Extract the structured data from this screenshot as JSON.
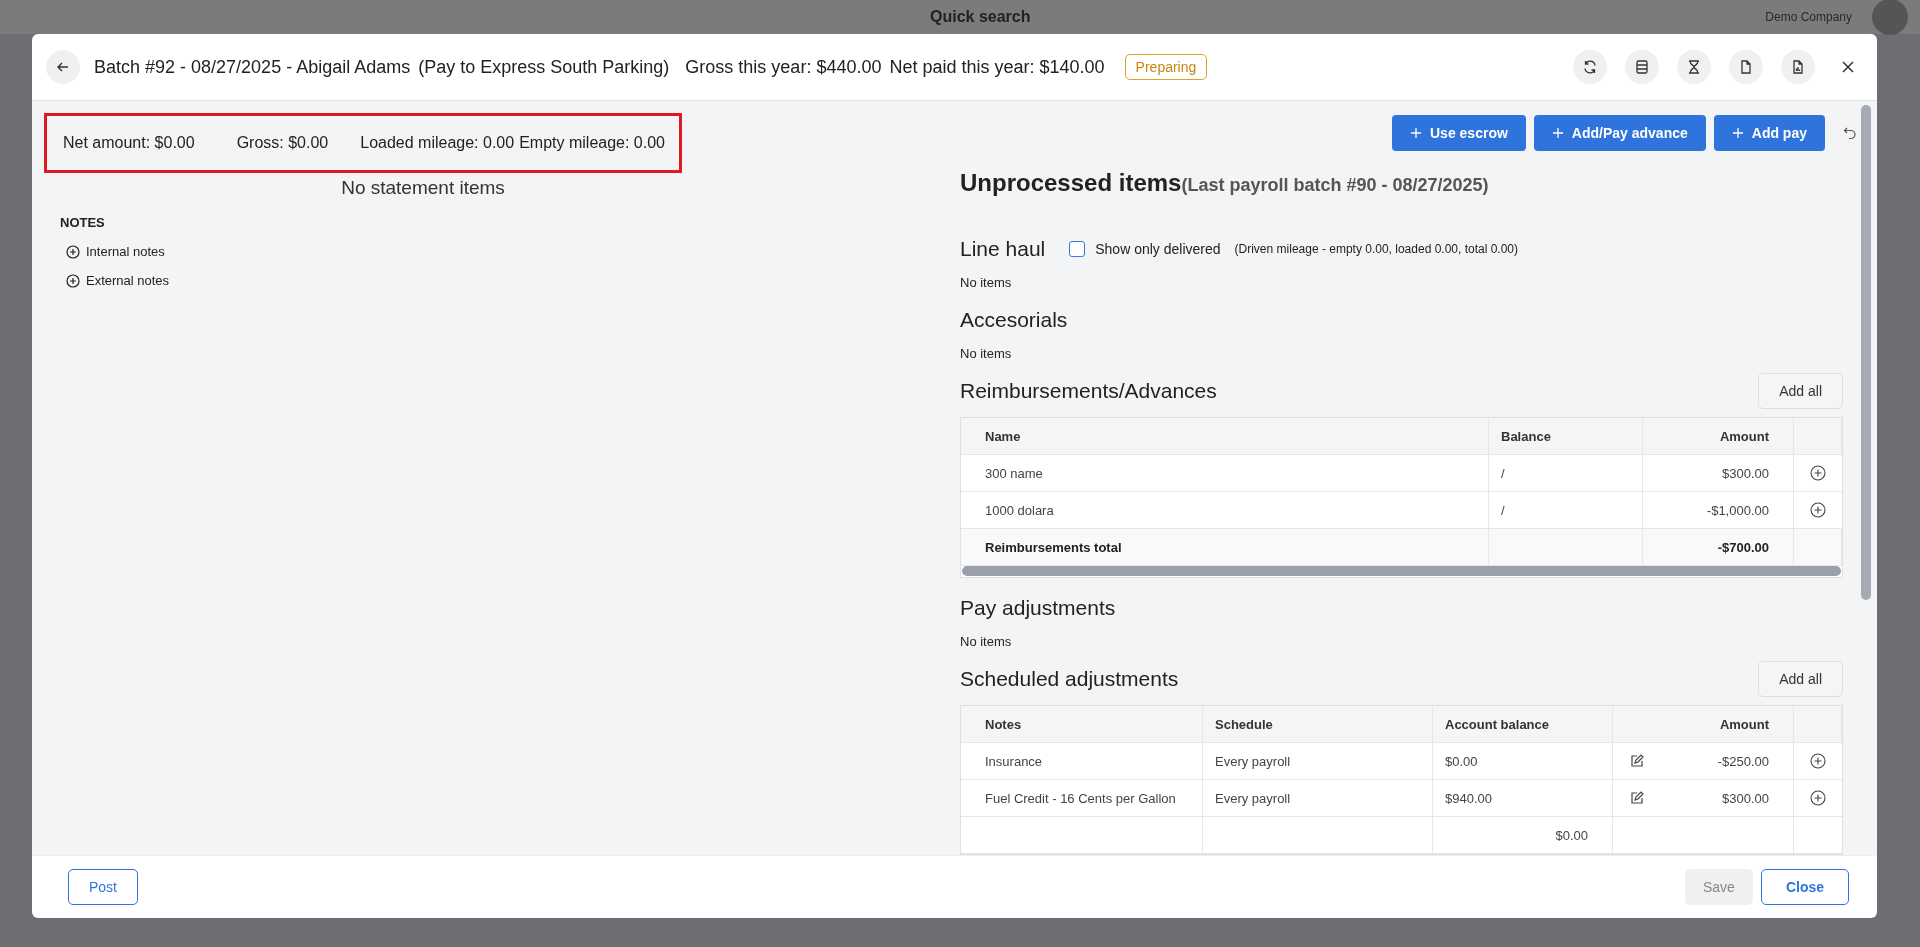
{
  "background": {
    "search_placeholder": "Quick search",
    "company": "Demo Company"
  },
  "modal": {
    "title": "Batch #92 - 08/27/2025 - Abigail Adams",
    "pay_to": "(Pay to Express South Parking)",
    "gross_year": "Gross this year: $440.00",
    "net_year": "Net paid this year: $140.00",
    "status": "Preparing"
  },
  "summary": [
    "Net amount: $0.00",
    "Gross: $0.00",
    "Loaded mileage: 0.00",
    "Empty mileage: 0.00"
  ],
  "statement_empty": "No statement items",
  "notes": {
    "title": "NOTES",
    "items": [
      "Internal notes",
      "External notes"
    ]
  },
  "actions": [
    "Use escrow",
    "Add/Pay advance",
    "Add pay"
  ],
  "unprocessed": {
    "title": "Unprocessed items",
    "subtitle": "(Last payroll batch #90 - 08/27/2025)"
  },
  "line_haul": {
    "title": "Line haul",
    "checkbox": {
      "label": "Show only delivered",
      "checked": false
    },
    "mileage": "(Driven mileage - empty 0.00, loaded 0.00, total 0.00)",
    "empty": "No items"
  },
  "accessorials": {
    "title": "Accesorials",
    "empty": "No items"
  },
  "reimbursements": {
    "title": "Reimbursements/Advances",
    "add_all": "Add all",
    "columns": [
      "Name",
      "Balance",
      "Amount"
    ],
    "rows": [
      {
        "name": "300 name",
        "balance": "/",
        "amount": "$300.00"
      },
      {
        "name": "1000 dolara",
        "balance": "/",
        "amount": "-$1,000.00"
      }
    ],
    "total": {
      "label": "Reimbursements total",
      "amount": "-$700.00"
    }
  },
  "pay_adjustments": {
    "title": "Pay adjustments",
    "empty": "No items"
  },
  "scheduled": {
    "title": "Scheduled adjustments",
    "add_all": "Add all",
    "columns": [
      "Notes",
      "Schedule",
      "Account balance",
      "Amount"
    ],
    "rows": [
      {
        "notes": "Insurance",
        "schedule": "Every payroll",
        "balance": "$0.00",
        "amount": "-$250.00"
      },
      {
        "notes": "Fuel Credit - 16 Cents per Gallon",
        "schedule": "Every payroll",
        "balance": "$940.00",
        "amount": "$300.00"
      },
      {
        "balance": "$0.00"
      }
    ]
  },
  "footer": {
    "post": "Post",
    "save": "Save",
    "save_disabled": true,
    "close": "Close"
  }
}
